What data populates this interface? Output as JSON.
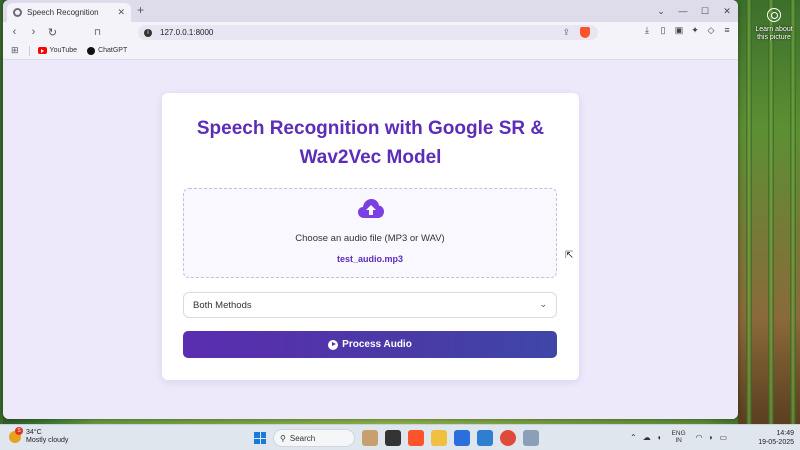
{
  "desktop": {
    "learn_text": "Learn about this picture"
  },
  "browser": {
    "tab_title": "Speech Recognition",
    "url": "127.0.0.1:8000",
    "bookmarks": [
      {
        "label": "YouTube",
        "icon": "youtube-icon"
      },
      {
        "label": "ChatGPT",
        "icon": "chatgpt-icon"
      }
    ]
  },
  "page": {
    "title": "Speech Recognition with Google SR & Wav2Vec Model",
    "upload_label": "Choose an audio file (MP3 or WAV)",
    "selected_file": "test_audio.mp3",
    "method_selected": "Both Methods",
    "process_button": "Process Audio",
    "colors": {
      "accent": "#5b2db8",
      "button_start": "#5b2db0",
      "button_end": "#3f46a8"
    }
  },
  "taskbar": {
    "weather_temp": "34°C",
    "weather_desc": "Mostly cloudy",
    "search_label": "Search",
    "lang_top": "ENG",
    "lang_bottom": "IN",
    "time": "14:49",
    "date": "19-05-2025"
  }
}
